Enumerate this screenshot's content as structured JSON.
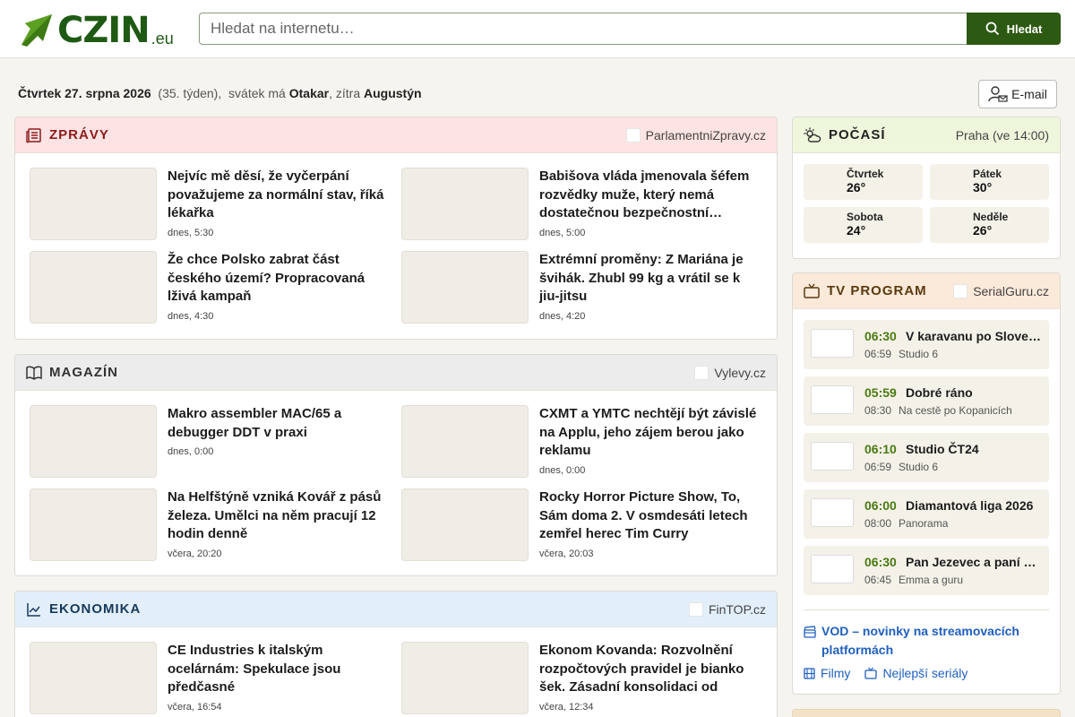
{
  "header": {
    "logo_text": "CZIN",
    "logo_suffix": ".eu",
    "search_placeholder": "Hledat na internetu…",
    "search_button": "Hledat"
  },
  "datebar": {
    "date": "Čtvrtek 27. srpna 2026",
    "week": "(35. týden),",
    "nameday_prefix": "svátek má",
    "nameday": "Otakar",
    "tomorrow_prefix": ", zítra",
    "tomorrow": "Augustýn",
    "email_button": "E-mail"
  },
  "zpravy": {
    "title": "ZPRÁVY",
    "source": "ParlamentniZpravy.cz",
    "color": "#fde3e3",
    "title_color": "#8c1b1b",
    "items": [
      {
        "title": "Nejvíc mě děsí, že vyčerpání považujeme za normální stav, říká lékařka",
        "time": "dnes, 5:30"
      },
      {
        "title": "Babišova vláda jmenovala šéfem rozvědky muže, který nemá dostatečnou bezpečnostní…",
        "time": "dnes, 5:00"
      },
      {
        "title": "Že chce Polsko zabrat část českého území? Propracovaná lživá kampaň",
        "time": "dnes, 4:30"
      },
      {
        "title": "Extrémní proměny: Z Mariána je švihák. Zhubl 99 kg a vrátil se k jiu-jitsu",
        "time": "dnes, 4:20"
      }
    ]
  },
  "magazin": {
    "title": "MAGAZÍN",
    "source": "Vylevy.cz",
    "color": "#ececec",
    "title_color": "#333333",
    "items": [
      {
        "title": "Makro assembler MAC/65 a debugger DDT v praxi",
        "time": "dnes, 0:00"
      },
      {
        "title": "CXMT a YMTC nechtějí být závislé na Applu, jeho zájem berou jako reklamu",
        "time": "dnes, 0:00"
      },
      {
        "title": "Na Helfštýně vzniká Kovář z pásů železa. Umělci na něm pracují 12 hodin denně",
        "time": "včera, 20:20"
      },
      {
        "title": "Rocky Horror Picture Show, To, Sám doma 2. V osmdesáti letech zemřel herec Tim Curry",
        "time": "včera, 20:03"
      }
    ]
  },
  "ekonomika": {
    "title": "EKONOMIKA",
    "source": "FinTOP.cz",
    "color": "#e2effb",
    "title_color": "#183a5c",
    "items": [
      {
        "title": "CE Industries k italským ocelárnám: Spekulace jsou předčasné",
        "time": "včera, 16:54"
      },
      {
        "title": "Ekonom Kovanda: Rozvolnění rozpočtových pravidel je bianko šek. Zásadní konsolidaci od vlád…",
        "time": "včera, 12:34"
      }
    ]
  },
  "pocasi": {
    "title": "POČASÍ",
    "location": "Praha (ve 14:00)",
    "color": "#eef6dc",
    "days": [
      {
        "day": "Čtvrtek",
        "temp": "26°"
      },
      {
        "day": "Pátek",
        "temp": "30°"
      },
      {
        "day": "Sobota",
        "temp": "24°"
      },
      {
        "day": "Neděle",
        "temp": "26°"
      }
    ]
  },
  "tv": {
    "title": "TV PROGRAM",
    "source": "SerialGuru.cz",
    "color": "#fbe9d9",
    "items": [
      {
        "time": "06:30",
        "title": "V karavanu po Slovensku",
        "next_time": "06:59",
        "next_title": "Studio 6"
      },
      {
        "time": "05:59",
        "title": "Dobré ráno",
        "next_time": "08:30",
        "next_title": "Na cestě po Kopanicích"
      },
      {
        "time": "06:10",
        "title": "Studio ČT24",
        "next_time": "06:59",
        "next_title": "Studio 6"
      },
      {
        "time": "06:00",
        "title": "Diamantová liga 2026",
        "next_time": "08:00",
        "next_title": "Panorama"
      },
      {
        "time": "06:30",
        "title": "Pan Jezevec a paní Lišková",
        "next_time": "06:45",
        "next_title": "Emma a guru"
      }
    ],
    "vod_link": "VOD – novinky na streamovacích platformách",
    "films_link": "Filmy",
    "series_link": "Nejlepší seriály"
  }
}
